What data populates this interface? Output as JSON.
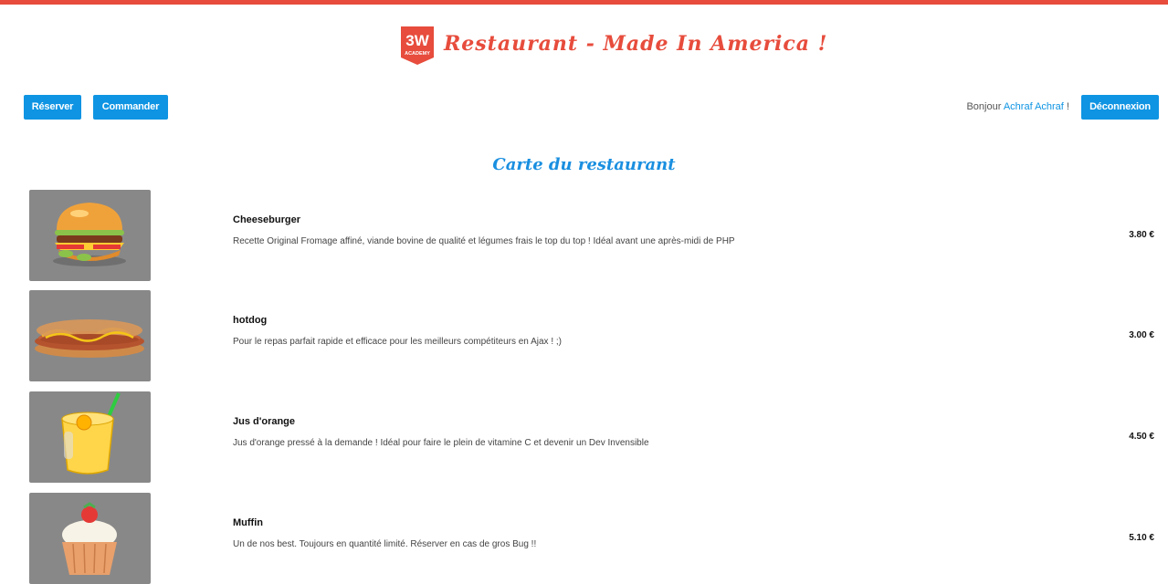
{
  "header": {
    "logo_text": "3W",
    "logo_subtext": "ACADEMY",
    "title": "Restaurant - Made In America !"
  },
  "nav": {
    "reserve_label": "Réserver",
    "order_label": "Commander",
    "greeting_prefix": "Bonjour ",
    "user_name": "Achraf Achraf",
    "greeting_suffix": " !",
    "logout_label": "Déconnexion"
  },
  "menu": {
    "title": "Carte du restaurant",
    "items": [
      {
        "name": "Cheeseburger",
        "description": "Recette Original Fromage affiné, viande bovine de qualité et légumes frais le top du top ! Idéal avant une après-midi de PHP",
        "price": "3.80 €",
        "icon": "burger-image"
      },
      {
        "name": "hotdog",
        "description": "Pour le repas parfait rapide et efficace pour les meilleurs compétiteurs en Ajax ! ;)",
        "price": "3.00 €",
        "icon": "hotdog-image"
      },
      {
        "name": "Jus d'orange",
        "description": "Jus d'orange pressé à la demande ! Idéal pour faire le plein de vitamine C et devenir un Dev Invensible",
        "price": "4.50 €",
        "icon": "orange-juice-image"
      },
      {
        "name": "Muffin",
        "description": "Un de nos best. Toujours en quantité limité. Réserver en cas de gros Bug !!",
        "price": "5.10 €",
        "icon": "muffin-image"
      }
    ]
  },
  "colors": {
    "accent_red": "#e74c3c",
    "button_blue": "#0e94e3",
    "thumb_gray": "#888888"
  }
}
